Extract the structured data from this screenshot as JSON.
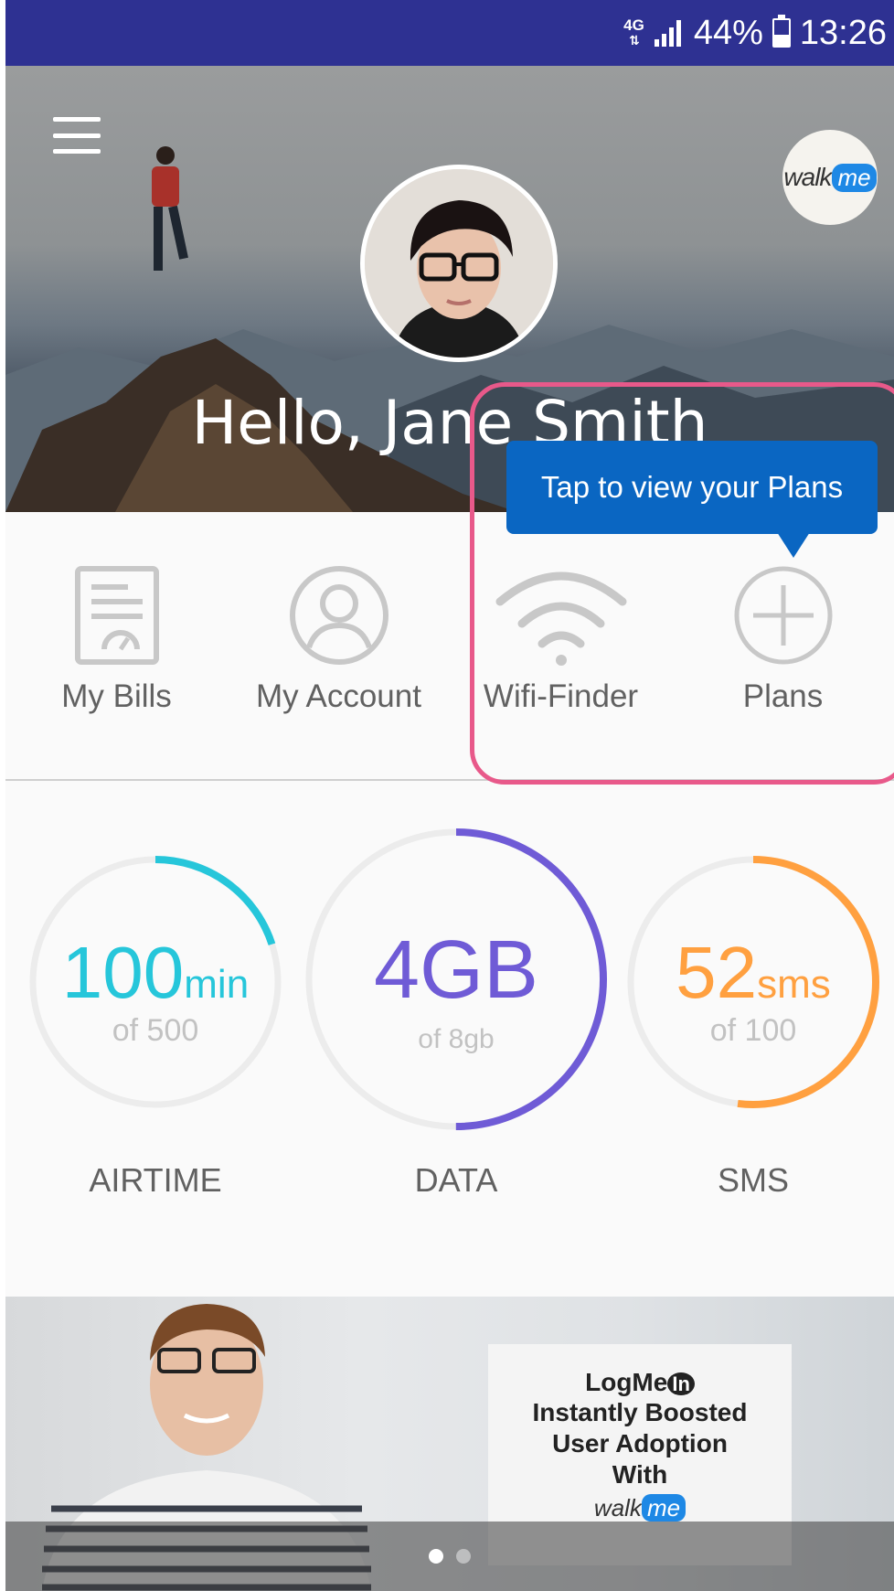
{
  "status_bar": {
    "network": "4G",
    "battery": "44%",
    "time": "13:26"
  },
  "header": {
    "greeting": "Hello, Jane Smith",
    "logo": {
      "word": "walk",
      "badge": "me"
    }
  },
  "quick_menu": [
    {
      "label": "My Bills",
      "icon": "bill-icon"
    },
    {
      "label": "My Account",
      "icon": "account-icon"
    },
    {
      "label": "Wifi-Finder",
      "icon": "wifi-icon"
    },
    {
      "label": "Plans",
      "icon": "plus-circle-icon"
    }
  ],
  "tooltip": {
    "text": "Tap to view your Plans"
  },
  "usage": {
    "airtime": {
      "value": "100",
      "unit": "min",
      "total": "of 500",
      "label": "AIRTIME",
      "used": 100,
      "max": 500,
      "color": "#26c6da"
    },
    "data": {
      "value": "4GB",
      "unit": "",
      "total": "of 8gb",
      "label": "DATA",
      "used": 4,
      "max": 8,
      "color": "#6f5bd6"
    },
    "sms": {
      "value": "52",
      "unit": "sms",
      "total": "of 100",
      "label": "SMS",
      "used": 52,
      "max": 100,
      "color": "#ffa040"
    }
  },
  "banner": {
    "brand": "LogMe",
    "brand_badge": "In",
    "lines": [
      "Instantly Boosted",
      "User Adoption",
      "With"
    ],
    "logo_word": "walk",
    "logo_badge": "me",
    "pages": 2,
    "active_page": 0
  },
  "colors": {
    "status_bar": "#2e3192",
    "tooltip": "#0a66c2",
    "highlight": "#e8598a"
  }
}
